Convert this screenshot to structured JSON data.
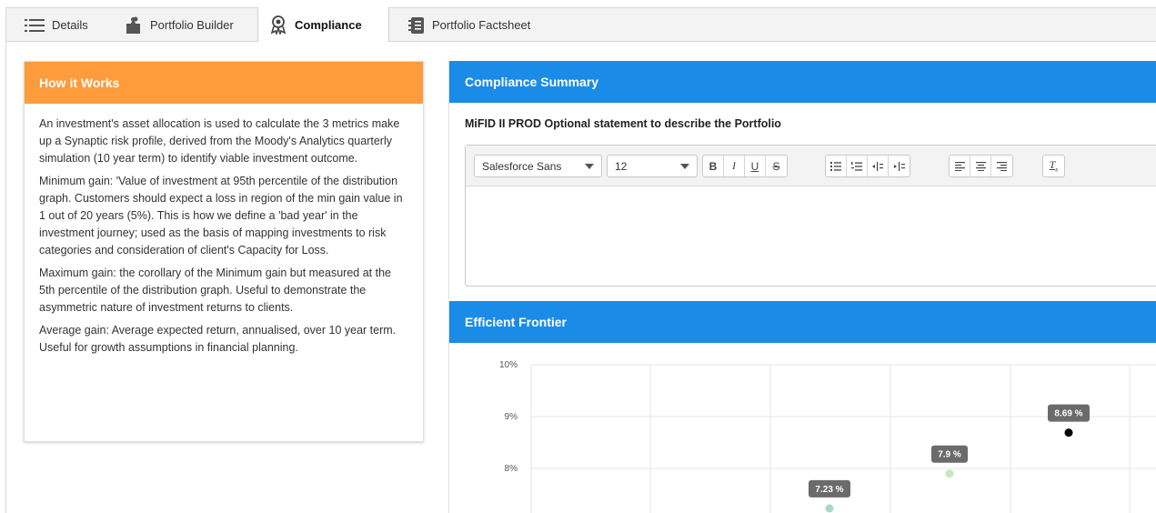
{
  "tabs": [
    {
      "label": "Details",
      "icon": "list-icon",
      "active": false
    },
    {
      "label": "Portfolio Builder",
      "icon": "puzzle-icon",
      "active": false
    },
    {
      "label": "Compliance",
      "icon": "award-icon",
      "active": true
    },
    {
      "label": "Portfolio Factsheet",
      "icon": "notebook-icon",
      "active": false
    }
  ],
  "how_it_works": {
    "title": "How it Works",
    "paragraphs": [
      "An investment's asset allocation is used to calculate the 3 metrics make up a Synaptic risk profile, derived from the Moody's Analytics quarterly simulation (10 year term) to identify viable investment outcome.",
      "Minimum gain: 'Value of investment at 95th percentile of the distribution graph. Customers should expect a loss in region of the min gain value in 1 out of 20 years (5%). This is how we define a 'bad year' in the investment journey; used as the basis of mapping investments to risk categories and consideration of client's Capacity for Loss.",
      "Maximum gain: the corollary of the Minimum gain but measured at the 5th percentile of the distribution graph. Useful to demonstrate the asymmetric nature of investment returns to clients.",
      "Average gain: Average expected return, annualised, over 10 year term. Useful for growth assumptions in financial planning."
    ]
  },
  "compliance_summary": {
    "title": "Compliance Summary",
    "statement_label": "MiFID II PROD Optional statement to describe the Portfolio",
    "editor": {
      "font_family": "Salesforce Sans",
      "font_size": "12",
      "value": ""
    }
  },
  "efficient_frontier": {
    "title": "Efficient Frontier"
  },
  "chart_data": {
    "type": "scatter",
    "title": "",
    "xlabel": "",
    "ylabel": "",
    "y_ticks": [
      "10%",
      "9%",
      "8%"
    ],
    "ylim": [
      7.2,
      10
    ],
    "grid": true,
    "points": [
      {
        "x": 3,
        "y": 7.23,
        "label": "7.23 %",
        "color": "#a8d8c8"
      },
      {
        "x": 4,
        "y": 7.9,
        "label": "7.9 %",
        "color": "#c5e8b8"
      },
      {
        "x": 5,
        "y": 8.69,
        "label": "8.69 %",
        "color": "#000000"
      }
    ]
  },
  "colors": {
    "orange_header": "#fe9b3a",
    "blue_header": "#1a8ce8"
  }
}
